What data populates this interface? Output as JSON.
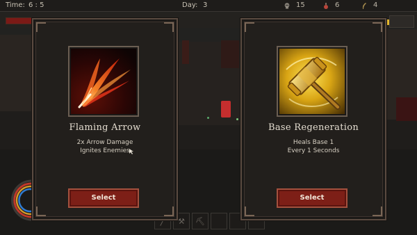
{
  "hud": {
    "time_label": "Time:",
    "time_value": "6 : 5",
    "day_label": "Day:",
    "day_value": "3",
    "resources": [
      {
        "icon": "skull-icon",
        "value": "15"
      },
      {
        "icon": "potion-icon",
        "value": "6"
      },
      {
        "icon": "feather-icon",
        "value": "4"
      }
    ]
  },
  "cards": [
    {
      "title": "Flaming Arrow",
      "description": [
        "2x Arrow Damage",
        "Ignites Enemies"
      ],
      "button": "Select",
      "icon": "flaming-arrow-icon"
    },
    {
      "title": "Base Regeneration",
      "description": [
        "Heals Base 1",
        "Every 1 Seconds"
      ],
      "button": "Select",
      "icon": "hammer-icon"
    }
  ],
  "colors": {
    "select_button": "#7d1f17",
    "card_border": "#5a4a40",
    "fire": "#ff5a1a",
    "gold": "#f5c21a"
  }
}
